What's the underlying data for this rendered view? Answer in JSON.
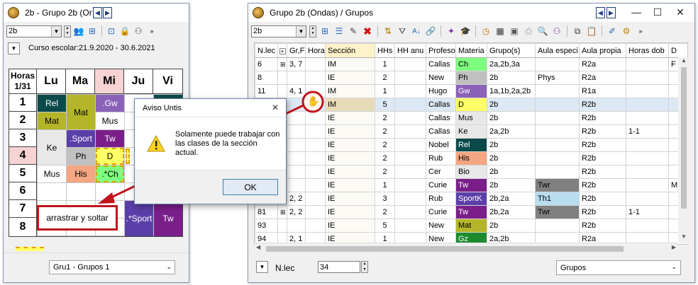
{
  "left_window": {
    "title": "2b - Grupo 2b (Or",
    "class_combo": "2b",
    "school_year": "Curso escolar:21.9.2020 - 30.6.2021",
    "hours_header": "Horas\n1/31",
    "days": [
      "Lu",
      "Ma",
      "Mi",
      "Ju",
      "Vi"
    ],
    "hours": [
      "1",
      "2",
      "3",
      "4",
      "5",
      "6",
      "7",
      "8"
    ],
    "lessons": {
      "lu_rel": "Rel",
      "lu_mat": "Mat",
      "lu_ke": "Ke",
      "lu_mus": "Mus",
      "ma_mat": "Mat",
      "ma_tw": "Tw",
      "ma_sport": ".Sport",
      "ma_ph": "Ph",
      "ma_his": "His",
      "mi_gw": ".Gw",
      "mi_mus": "Mus",
      "mi_tw": "Tw",
      "mi_d": "D",
      "mi_ch": ".*Ch",
      "ju_sport": ".*Sport",
      "vi_tw": "Tw"
    },
    "drag_label": "arrastrar y soltar",
    "footer_select": "Gru1 - Grupos 1"
  },
  "dialog": {
    "title": "Aviso Untis",
    "message": "Solamente puede trabajar con las clases de la sección actual.",
    "ok_label": "OK"
  },
  "right_window": {
    "title": "Grupo 2b (Ondas) / Grupos",
    "class_combo": "2b",
    "columns": [
      "N.lec",
      "",
      "Gr,F",
      "Hora",
      "Sección",
      "HHs",
      "HH anu",
      "Profeso",
      "Materia",
      "Grupo(s)",
      "Aula especi",
      "Aula propia",
      "Horas dob",
      "D"
    ],
    "rows": [
      {
        "nlec": "6",
        "plus": "⊞",
        "gr": "3, 7",
        "hora": "",
        "seccion": "IM",
        "hhs": "1",
        "hhanu": "",
        "prof": "Callas",
        "materia": "Ch",
        "mat_color": "#7fff7f",
        "mat_text": "#000",
        "grupos": "2a,2b,3a",
        "aula_esp": "",
        "aula_esp_color": "",
        "aula_propia": "R2a",
        "horas_dob": "",
        "d": "F"
      },
      {
        "nlec": "8",
        "plus": "",
        "gr": "",
        "hora": "",
        "seccion": "IE",
        "hhs": "2",
        "hhanu": "",
        "prof": "New",
        "materia": "Ph",
        "mat_color": "#c0c0c0",
        "mat_text": "#000",
        "grupos": "2b",
        "aula_esp": "Phys",
        "aula_esp_color": "",
        "aula_propia": "R2a",
        "horas_dob": "",
        "d": ""
      },
      {
        "nlec": "11",
        "plus": "",
        "gr": "4, 1",
        "hora": "",
        "seccion": "IM",
        "hhs": "1",
        "hhanu": "",
        "prof": "Hugo",
        "materia": "Gw",
        "mat_color": "#8a62b8",
        "mat_text": "#fff",
        "grupos": "1a,1b,2a,2b",
        "aula_esp": "",
        "aula_esp_color": "",
        "aula_propia": "R1a",
        "horas_dob": "",
        "d": ""
      },
      {
        "nlec": "",
        "plus": "",
        "gr": "",
        "hora": "",
        "seccion": "IM",
        "hhs": "5",
        "hhanu": "",
        "prof": "Callas",
        "materia": "D",
        "mat_color": "#ffff66",
        "mat_text": "#000",
        "grupos": "2b",
        "aula_esp": "",
        "aula_esp_color": "",
        "aula_propia": "R2b",
        "horas_dob": "",
        "d": ""
      },
      {
        "nlec": "",
        "plus": "",
        "gr": "",
        "hora": "",
        "seccion": "IE",
        "hhs": "2",
        "hhanu": "",
        "prof": "Callas",
        "materia": "Mus",
        "mat_color": "#e8e8e8",
        "mat_text": "#000",
        "grupos": "2b",
        "aula_esp": "",
        "aula_esp_color": "",
        "aula_propia": "R2b",
        "horas_dob": "",
        "d": ""
      },
      {
        "nlec": "",
        "plus": "",
        "gr": "",
        "hora": "",
        "seccion": "IE",
        "hhs": "2",
        "hhanu": "",
        "prof": "Callas",
        "materia": "Ke",
        "mat_color": "#e8e8e8",
        "mat_text": "#000",
        "grupos": "2a,2b",
        "aula_esp": "",
        "aula_esp_color": "",
        "aula_propia": "R2b",
        "horas_dob": "1-1",
        "d": ""
      },
      {
        "nlec": "",
        "plus": "",
        "gr": "",
        "hora": "",
        "seccion": "IE",
        "hhs": "2",
        "hhanu": "",
        "prof": "Nobel",
        "materia": "Rel",
        "mat_color": "#0b4a4a",
        "mat_text": "#fff",
        "grupos": "2b",
        "aula_esp": "",
        "aula_esp_color": "",
        "aula_propia": "R2b",
        "horas_dob": "",
        "d": ""
      },
      {
        "nlec": "",
        "plus": "",
        "gr": "",
        "hora": "",
        "seccion": "IE",
        "hhs": "2",
        "hhanu": "",
        "prof": "Rub",
        "materia": "His",
        "mat_color": "#f4a582",
        "mat_text": "#000",
        "grupos": "2b",
        "aula_esp": "",
        "aula_esp_color": "",
        "aula_propia": "R2b",
        "horas_dob": "",
        "d": ""
      },
      {
        "nlec": "",
        "plus": "",
        "gr": "",
        "hora": "",
        "seccion": "IE",
        "hhs": "2",
        "hhanu": "",
        "prof": "Cer",
        "materia": "Bio",
        "mat_color": "#e8e8e8",
        "mat_text": "#000",
        "grupos": "2b",
        "aula_esp": "",
        "aula_esp_color": "",
        "aula_propia": "R2b",
        "horas_dob": "",
        "d": ""
      },
      {
        "nlec": "",
        "plus": "",
        "gr": "",
        "hora": "",
        "seccion": "IE",
        "hhs": "1",
        "hhanu": "",
        "prof": "Curie",
        "materia": "Tw",
        "mat_color": "#7a1f8a",
        "mat_text": "#fff",
        "grupos": "2b",
        "aula_esp": "Twr",
        "aula_esp_color": "#808080",
        "aula_propia": "R2b",
        "horas_dob": "",
        "d": "M"
      },
      {
        "nlec": "",
        "plus": "",
        "gr": "2, 2",
        "hora": "",
        "seccion": "IE",
        "hhs": "3",
        "hhanu": "",
        "prof": "Rub",
        "materia": "SportK",
        "mat_color": "#5b3fa8",
        "mat_text": "#fff",
        "grupos": "2b,2a",
        "aula_esp": "Th1",
        "aula_esp_color": "#b8dcf0",
        "aula_propia": "R2b",
        "horas_dob": "",
        "d": ""
      },
      {
        "nlec": "81",
        "plus": "⊞",
        "gr": "2, 2",
        "hora": "",
        "seccion": "IE",
        "hhs": "2",
        "hhanu": "",
        "prof": "Curie",
        "materia": "Tw",
        "mat_color": "#7a1f8a",
        "mat_text": "#fff",
        "grupos": "2b,2a",
        "aula_esp": "Twr",
        "aula_esp_color": "#808080",
        "aula_propia": "R2b",
        "horas_dob": "1-1",
        "d": ""
      },
      {
        "nlec": "93",
        "plus": "",
        "gr": "",
        "hora": "",
        "seccion": "IE",
        "hhs": "5",
        "hhanu": "",
        "prof": "New",
        "materia": "Mat",
        "mat_color": "#b5b52a",
        "mat_text": "#000",
        "grupos": "2b",
        "aula_esp": "",
        "aula_esp_color": "",
        "aula_propia": "R2b",
        "horas_dob": "",
        "d": ""
      },
      {
        "nlec": "94",
        "plus": "",
        "gr": "2, 1",
        "hora": "",
        "seccion": "IE",
        "hhs": "1",
        "hhanu": "",
        "prof": "New",
        "materia": "Gz",
        "mat_color": "#1e8a2e",
        "mat_text": "#fff",
        "grupos": "2a,2b",
        "aula_esp": "",
        "aula_esp_color": "",
        "aula_propia": "R2a",
        "horas_dob": "",
        "d": ""
      }
    ],
    "footer_field_label": "N.lec",
    "footer_field_value": "34",
    "footer_select": "Grupos"
  },
  "colors": {
    "accent_red": "#c0141c",
    "selected_row": "#dde8f5",
    "header_highlight": "#fff2c8"
  }
}
